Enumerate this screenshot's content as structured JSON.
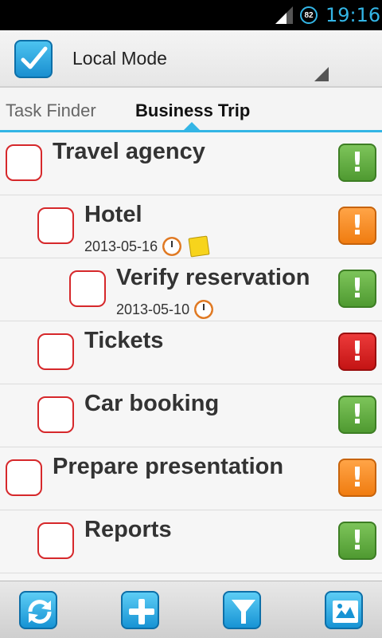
{
  "status_bar": {
    "battery_level": "82",
    "time": "19:16",
    "signal_icon": "signal-icon"
  },
  "action_bar": {
    "app_icon": "checkbox-app-icon",
    "title": "Local Mode"
  },
  "tabs": [
    {
      "label": "Task Finder",
      "selected": false
    },
    {
      "label": "Business Trip",
      "selected": true
    }
  ],
  "tasks": [
    {
      "title": "Travel agency",
      "indent": 0,
      "date": "",
      "has_alarm": false,
      "has_note": false,
      "priority": "green"
    },
    {
      "title": "Hotel",
      "indent": 1,
      "date": "2013-05-16",
      "has_alarm": true,
      "has_note": true,
      "priority": "orange"
    },
    {
      "title": "Verify reservation",
      "indent": 2,
      "date": "2013-05-10",
      "has_alarm": true,
      "has_note": false,
      "priority": "green"
    },
    {
      "title": "Tickets",
      "indent": 1,
      "date": "",
      "has_alarm": false,
      "has_note": false,
      "priority": "red"
    },
    {
      "title": "Car booking",
      "indent": 1,
      "date": "",
      "has_alarm": false,
      "has_note": false,
      "priority": "green"
    },
    {
      "title": "Prepare presentation",
      "indent": 0,
      "date": "",
      "has_alarm": false,
      "has_note": false,
      "priority": "orange"
    },
    {
      "title": "Reports",
      "indent": 1,
      "date": "",
      "has_alarm": false,
      "has_note": false,
      "priority": "green"
    }
  ],
  "priority_symbol": "!",
  "colors": {
    "accent": "#33b5e5",
    "checkbox_border": "#d6282b",
    "priority_green": "#5fa93d",
    "priority_orange": "#f78b1f",
    "priority_red": "#d62020"
  },
  "bottom_bar": {
    "buttons": [
      "sync-icon",
      "add-icon",
      "filter-icon",
      "map-icon"
    ]
  }
}
